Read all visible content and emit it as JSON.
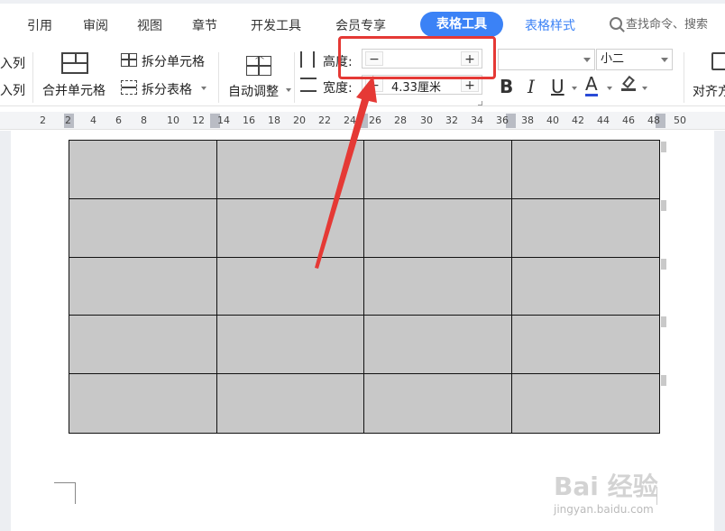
{
  "tabs": [
    "引用",
    "审阅",
    "视图",
    "章节",
    "开发工具",
    "会员专享"
  ],
  "active_tab": "表格工具",
  "style_tab": "表格样式",
  "search_placeholder": "查找命令、搜索",
  "ribbon": {
    "insert_col_left": "入列",
    "insert_col_right": "入列",
    "merge_cells": "合并单元格",
    "split_cells": "拆分单元格",
    "split_table": "拆分表格",
    "auto_fit": "自动调整",
    "height_label": "高度:",
    "width_label": "宽度:",
    "height_value": "",
    "width_value": "4.33厘米",
    "font_size": "小二",
    "bold": "B",
    "italic": "I",
    "underline": "U",
    "font_color": "A",
    "align": "对齐方"
  },
  "ruler": {
    "numbers": [
      "2",
      "2",
      "4",
      "6",
      "8",
      "10",
      "12",
      "14",
      "16",
      "18",
      "20",
      "22",
      "24",
      "26",
      "28",
      "30",
      "32",
      "34",
      "36",
      "38",
      "40",
      "42",
      "44",
      "46",
      "48",
      "50"
    ]
  },
  "table": {
    "rows": 5,
    "cols": 4
  },
  "watermark": {
    "logo_text": "Bai 经验",
    "url": "jingyan.baidu.com"
  },
  "colors": {
    "accent": "#3b82f6",
    "annotation_red": "#e53935",
    "cell_fill": "#c8c8c8"
  }
}
